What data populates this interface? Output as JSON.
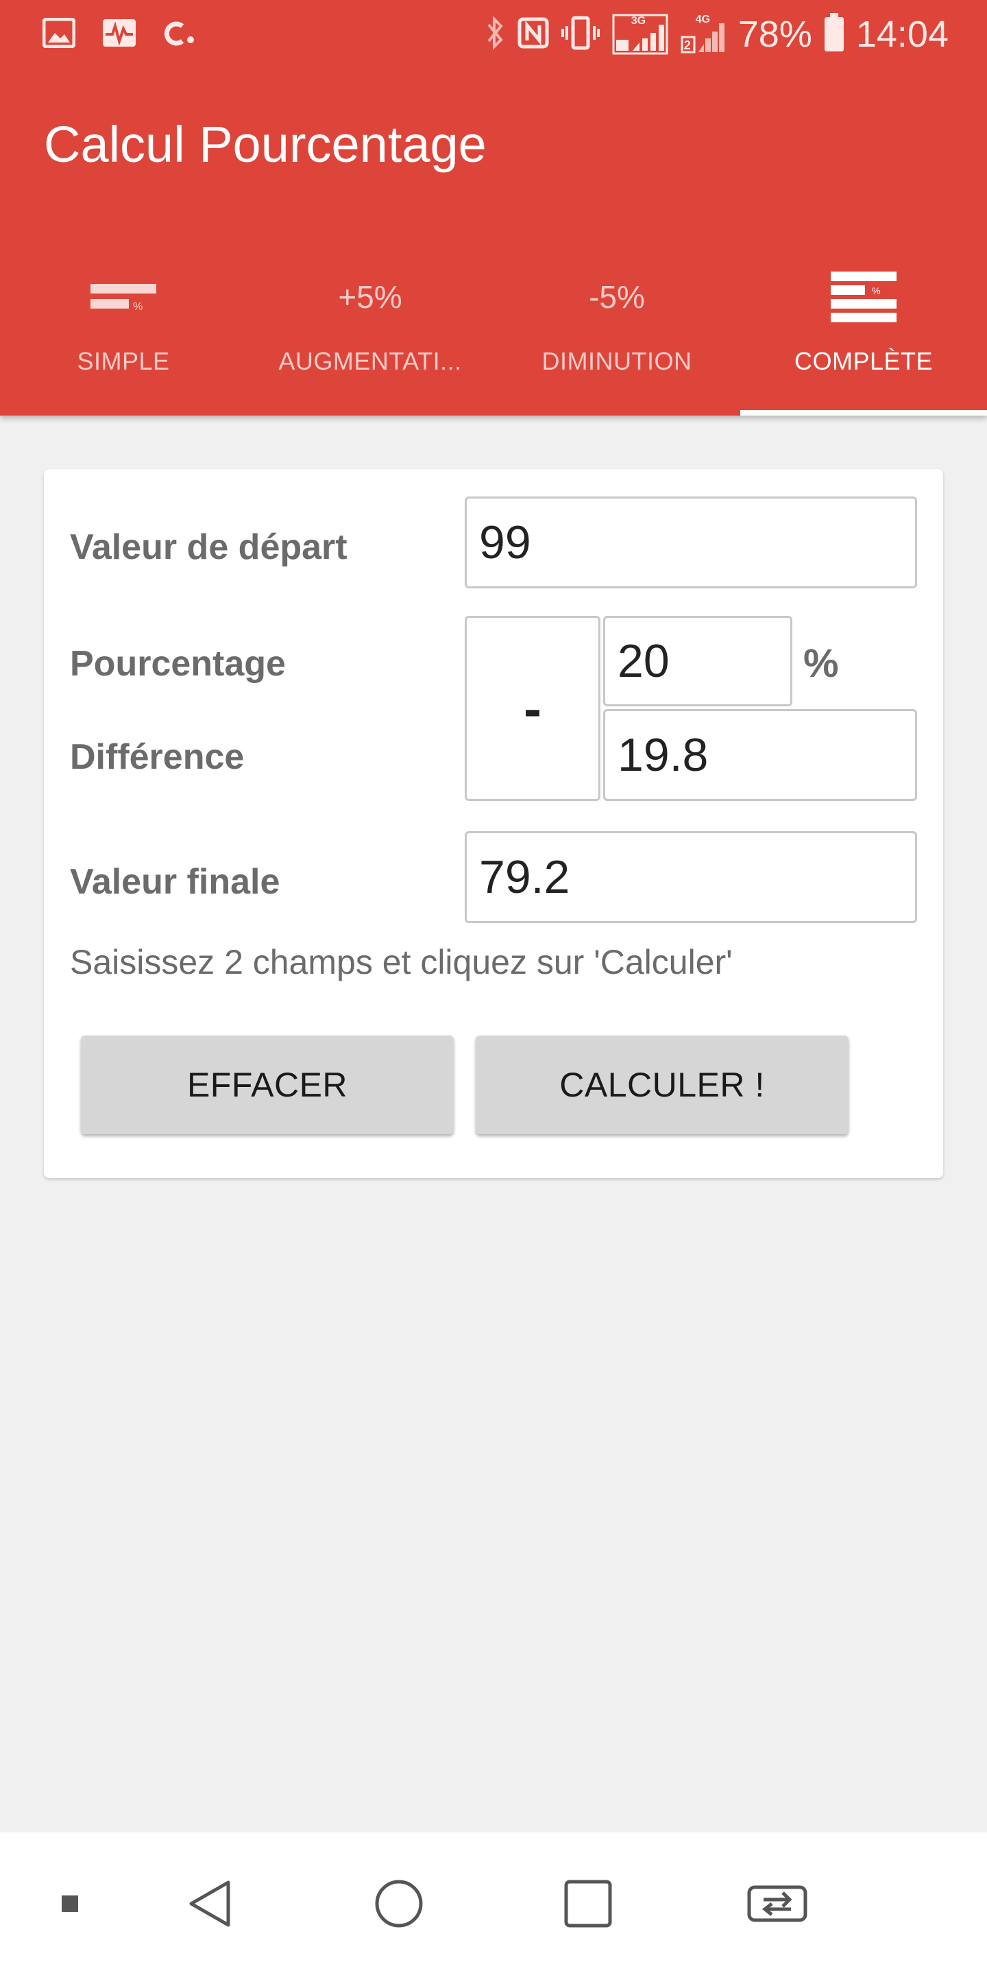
{
  "status_bar": {
    "left_icons": [
      "image-icon",
      "activity-icon",
      "c-app-icon"
    ],
    "right_icons": [
      "bluetooth-icon",
      "nfc-icon",
      "vibrate-icon",
      "signal-3g-icon",
      "signal-4g-icon"
    ],
    "network_3g": "3G",
    "network_4g": "4G",
    "sim": "2",
    "battery_percent": "78%",
    "time": "14:04"
  },
  "app": {
    "title": "Calcul Pourcentage",
    "accent_color": "#dd453a"
  },
  "tabs": [
    {
      "label": "SIMPLE",
      "icon": "bar-percent-icon",
      "icon_text": "%"
    },
    {
      "label": "AUGMENTATI...",
      "icon_text": "+5%"
    },
    {
      "label": "DIMINUTION",
      "icon_text": "-5%"
    },
    {
      "label": "COMPLÈTE",
      "icon": "multi-bar-percent-icon",
      "icon_text": "%"
    }
  ],
  "active_tab": "COMPLÈTE",
  "form": {
    "start_label": "Valeur de départ",
    "start_value": "99",
    "percentage_label": "Pourcentage",
    "operator": "-",
    "percentage_value": "20",
    "percent_sign": "%",
    "difference_label": "Différence",
    "difference_value": "19.8",
    "final_label": "Valeur finale",
    "final_value": "79.2",
    "hint": "Saisissez 2 champs et cliquez sur 'Calculer'",
    "clear_button": "EFFACER",
    "calculate_button": "CALCULER !"
  },
  "nav_bar": {
    "buttons": [
      "small-square-icon",
      "back-icon",
      "home-icon",
      "recents-icon",
      "switch-sim-icon"
    ]
  }
}
